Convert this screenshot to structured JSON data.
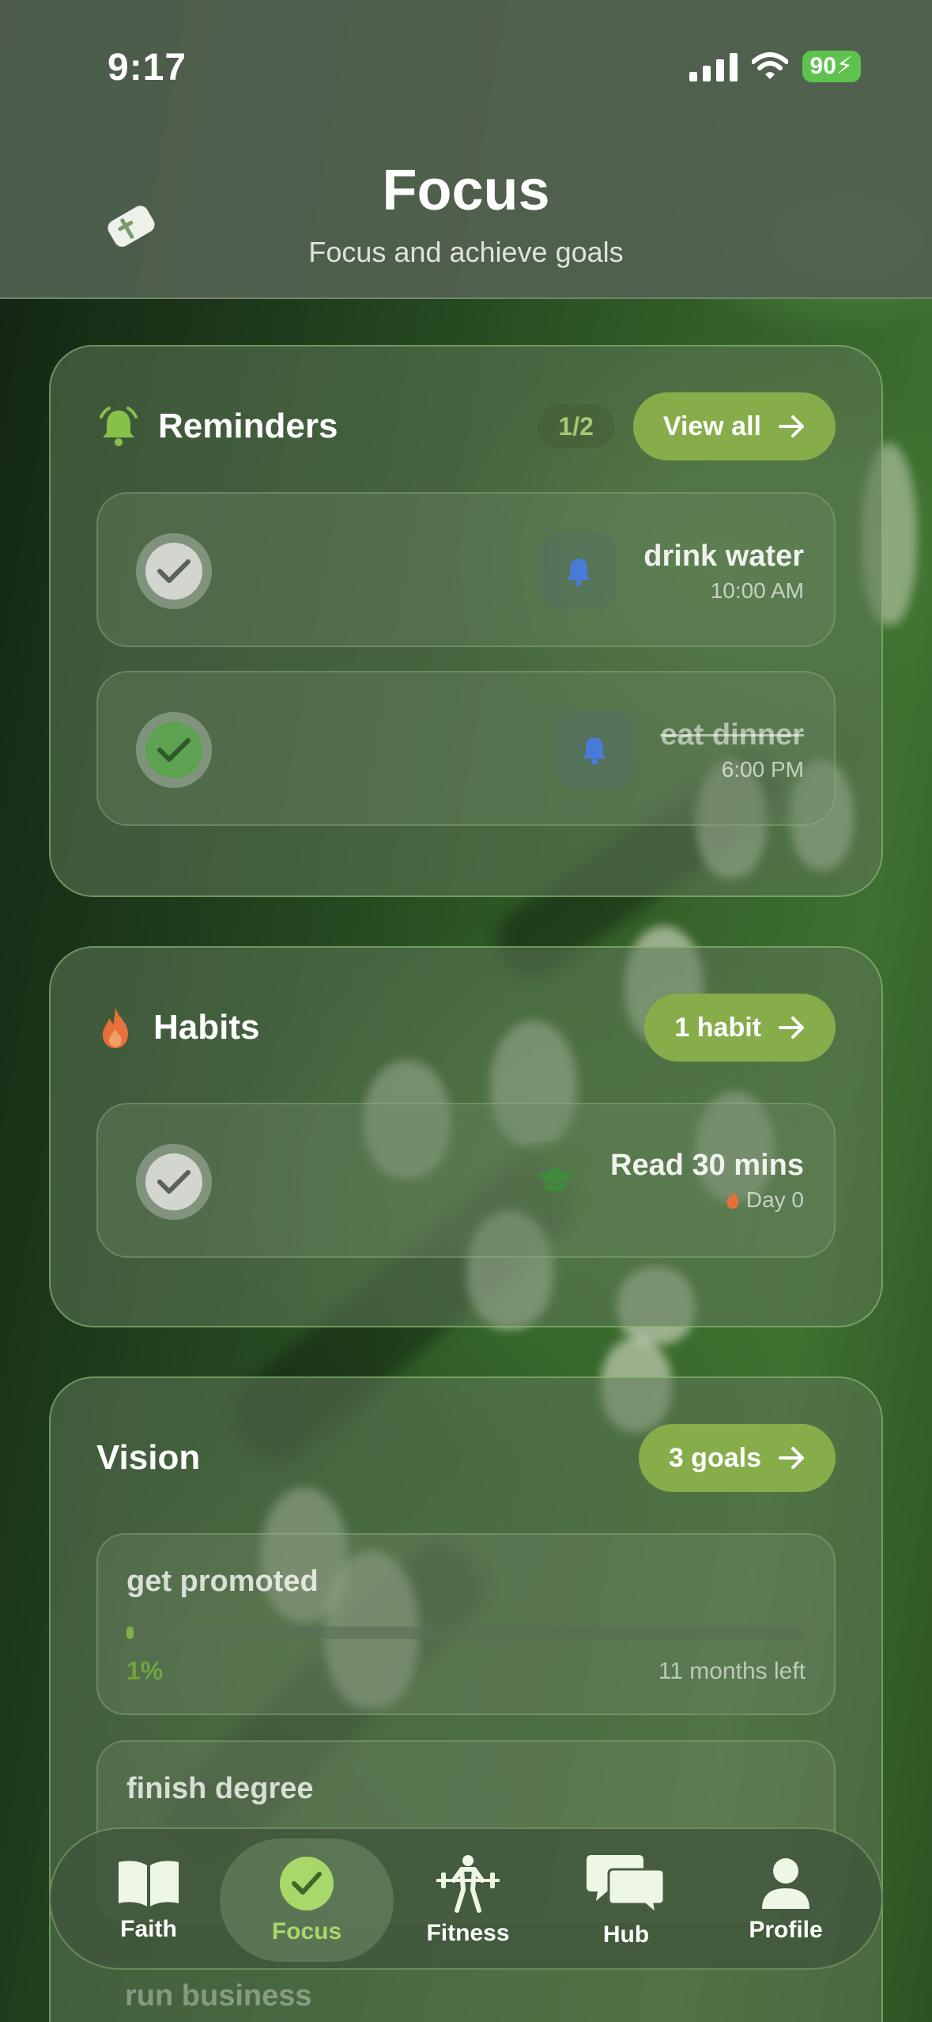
{
  "status": {
    "time": "9:17",
    "battery": "90"
  },
  "header": {
    "title": "Focus",
    "subtitle": "Focus and achieve goals"
  },
  "reminders": {
    "title": "Reminders",
    "count": "1/2",
    "button": "View all",
    "items": [
      {
        "title": "drink water",
        "time": "10:00 AM",
        "done": false
      },
      {
        "title": "eat dinner",
        "time": "6:00 PM",
        "done": true
      }
    ]
  },
  "habits": {
    "title": "Habits",
    "button": "1 habit",
    "items": [
      {
        "title": "Read 30 mins",
        "streak": "Day 0"
      }
    ]
  },
  "vision": {
    "title": "Vision",
    "button": "3 goals",
    "goals": [
      {
        "name": "get promoted",
        "percent": "1%",
        "progress": 0.01,
        "left": "11 months left"
      },
      {
        "name": "finish degree"
      },
      {
        "name": "run business"
      }
    ]
  },
  "tabs": [
    {
      "label": "Faith"
    },
    {
      "label": "Focus",
      "active": true
    },
    {
      "label": "Fitness"
    },
    {
      "label": "Hub"
    },
    {
      "label": "Profile"
    }
  ],
  "colors": {
    "accent": "#86ad4a",
    "active_tab": "#a9d86a",
    "flame": "#e8703a",
    "bell": "#4a7ad8"
  }
}
